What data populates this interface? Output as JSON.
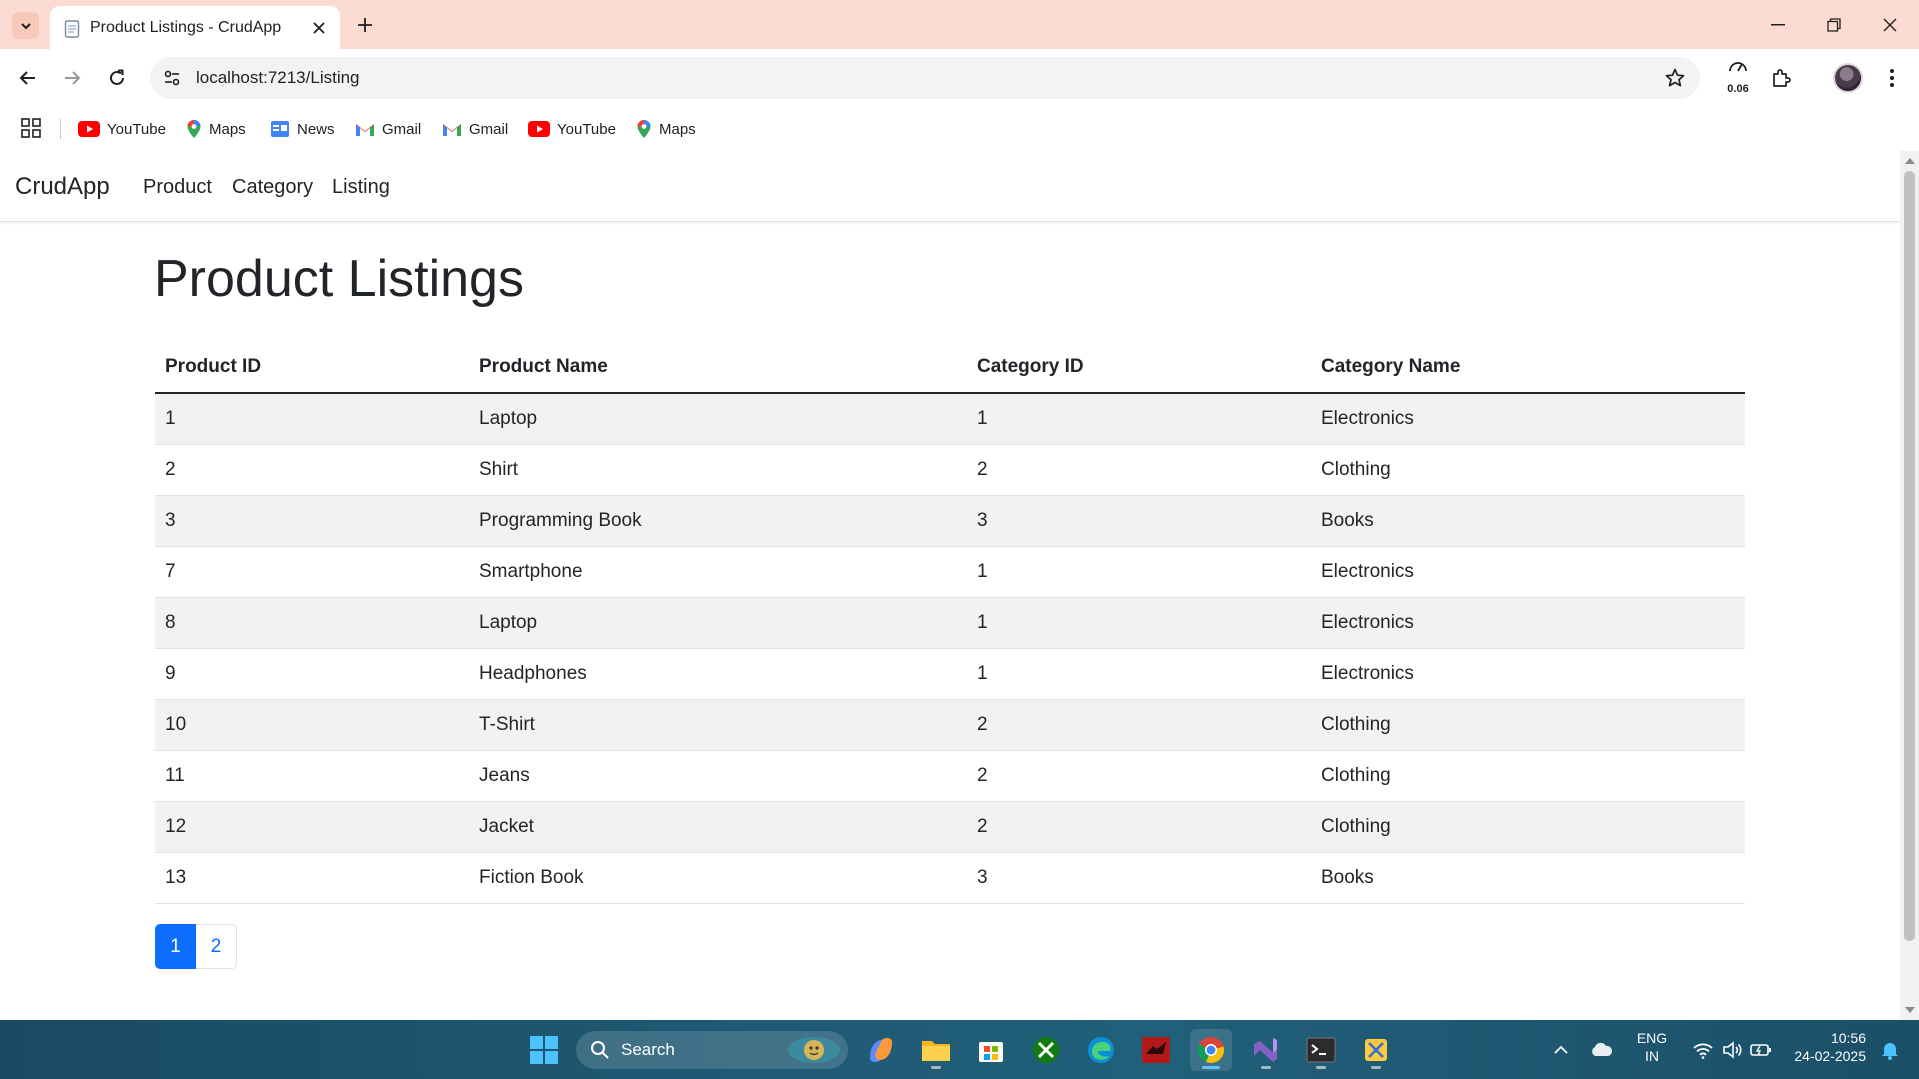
{
  "browser": {
    "tab_title": "Product Listings - CrudApp",
    "url": "localhost:7213/Listing",
    "perf_value": "0.06",
    "bookmarks": [
      {
        "label": "YouTube",
        "icon": "youtube-icon"
      },
      {
        "label": "Maps",
        "icon": "maps-icon"
      },
      {
        "label": "News",
        "icon": "news-icon"
      },
      {
        "label": "Gmail",
        "icon": "gmail-icon"
      },
      {
        "label": "Gmail",
        "icon": "gmail-icon"
      },
      {
        "label": "YouTube",
        "icon": "youtube-icon"
      },
      {
        "label": "Maps",
        "icon": "maps-icon"
      }
    ]
  },
  "app": {
    "brand": "CrudApp",
    "nav": [
      {
        "label": "Product"
      },
      {
        "label": "Category"
      },
      {
        "label": "Listing"
      }
    ]
  },
  "page": {
    "heading": "Product Listings",
    "columns": [
      "Product ID",
      "Product Name",
      "Category ID",
      "Category Name"
    ],
    "rows": [
      [
        "1",
        "Laptop",
        "1",
        "Electronics"
      ],
      [
        "2",
        "Shirt",
        "2",
        "Clothing"
      ],
      [
        "3",
        "Programming Book",
        "3",
        "Books"
      ],
      [
        "7",
        "Smartphone",
        "1",
        "Electronics"
      ],
      [
        "8",
        "Laptop",
        "1",
        "Electronics"
      ],
      [
        "9",
        "Headphones",
        "1",
        "Electronics"
      ],
      [
        "10",
        "T-Shirt",
        "2",
        "Clothing"
      ],
      [
        "11",
        "Jeans",
        "2",
        "Clothing"
      ],
      [
        "12",
        "Jacket",
        "2",
        "Clothing"
      ],
      [
        "13",
        "Fiction Book",
        "3",
        "Books"
      ]
    ],
    "pagination": {
      "pages": [
        "1",
        "2"
      ],
      "current": "1"
    }
  },
  "taskbar": {
    "search_label": "Search",
    "lang_line1": "ENG",
    "lang_line2": "IN",
    "time": "10:56",
    "date": "24-02-2025"
  },
  "colors": {
    "tabstrip": "#fcdcd2",
    "accent": "#0d6efd",
    "taskbar": "#1f5a74"
  }
}
